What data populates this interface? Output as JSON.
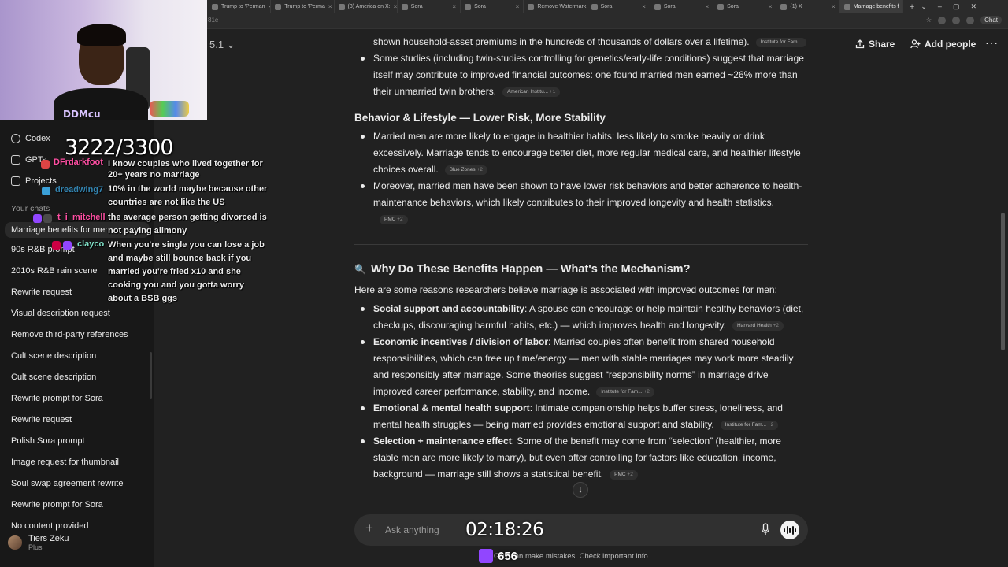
{
  "browser": {
    "tabs": [
      {
        "label": "Trump to 'Perman"
      },
      {
        "label": "Trump to 'Perma"
      },
      {
        "label": "(3) America on X:"
      },
      {
        "label": "Sora"
      },
      {
        "label": "Sora"
      },
      {
        "label": "Remove Watermark"
      },
      {
        "label": "Sora"
      },
      {
        "label": "Sora"
      },
      {
        "label": "Sora"
      },
      {
        "label": "(1) X"
      },
      {
        "label": "Marriage benefits f"
      }
    ],
    "url_fragment": "81e",
    "ext_chat_label": "Chat"
  },
  "sidebar": {
    "items": [
      {
        "label": "Codex"
      },
      {
        "label": "GPTs"
      },
      {
        "label": "Projects"
      }
    ],
    "section_label": "Your chats",
    "chats": [
      {
        "label": "Marriage benefits for men"
      },
      {
        "label": "90s R&B prompt"
      },
      {
        "label": "2010s R&B rain scene"
      },
      {
        "label": "Rewrite request"
      },
      {
        "label": "Visual description request"
      },
      {
        "label": "Remove third-party references"
      },
      {
        "label": "Cult scene description"
      },
      {
        "label": "Cult scene description"
      },
      {
        "label": "Rewrite prompt for Sora"
      },
      {
        "label": "Rewrite request"
      },
      {
        "label": "Polish Sora prompt"
      },
      {
        "label": "Image request for thumbnail"
      },
      {
        "label": "Soul swap agreement rewrite"
      },
      {
        "label": "Rewrite prompt for Sora"
      },
      {
        "label": "No content provided"
      }
    ],
    "user": {
      "name": "Tiers Zeku",
      "plan": "Plus"
    }
  },
  "header": {
    "model_label": "5.1 ⌄",
    "share_label": "Share",
    "add_people_label": "Add people",
    "more_label": "···"
  },
  "content": {
    "frag1_tail": "shown household-asset premiums in the hundreds of thousands of dollars over a lifetime).",
    "frag1_cite": "Institute for Fam...",
    "b1": {
      "text": "Some studies (including twin-studies controlling for genetics/early-life conditions) suggest that marriage itself may contribute to improved financial outcomes: one found married men earned ~26% more than their unmarried twin brothers.",
      "cite": "American Institu...",
      "cite_more": "+1"
    },
    "h_behavior": "Behavior & Lifestyle — Lower Risk, More Stability",
    "b2": {
      "text": "Married men are more likely to engage in healthier habits: less likely to smoke heavily or drink excessively. Marriage tends to encourage better diet, more regular medical care, and healthier lifestyle choices overall.",
      "cite": "Blue Zones",
      "cite_more": "+2"
    },
    "b3": {
      "text": "Moreover, married men have been shown to have lower risk behaviors and better adherence to health-maintenance behaviors, which likely contributes to their improved longevity and health statistics.",
      "cite": "PMC",
      "cite_more": "+2"
    },
    "h_mechanism_icon": "🔍",
    "h_mechanism": "Why Do These Benefits Happen — What's the Mechanism?",
    "intro": "Here are some reasons researchers believe marriage is associated with improved outcomes for men:",
    "m1": {
      "bold": "Social support and accountability",
      "text": ": A spouse can encourage or help maintain healthy behaviors (diet, checkups, discouraging harmful habits, etc.) — which improves health and longevity.",
      "cite": "Harvard Health",
      "cite_more": "+2"
    },
    "m2": {
      "bold": "Economic incentives / division of labor",
      "text": ": Married couples often benefit from shared household responsibilities, which can free up time/energy — men with stable marriages may work more steadily and responsibly after marriage. Some theories suggest “responsibility norms” in marriage drive improved career performance, stability, and income.",
      "cite": "Institute for Fam...",
      "cite_more": "+2"
    },
    "m3": {
      "bold": "Emotional & mental health support",
      "text": ": Intimate companionship helps buffer stress, loneliness, and mental health struggles — being married provides emotional support and stability.",
      "cite": "Institute for Fam...",
      "cite_more": "+2"
    },
    "m4": {
      "bold": "Selection + maintenance effect",
      "text": ": Some of the benefit may come from “selection” (healthier, more stable men are more likely to marry), but even after controlling for factors like education, income, background — marriage still shows a statistical benefit.",
      "cite": "PMC",
      "cite_more": "+2"
    }
  },
  "composer": {
    "placeholder": "Ask anything",
    "disclaimer": "GPT can make mistakes. Check important info."
  },
  "overlay": {
    "counter": "3222/3300",
    "timer": "02:18:26",
    "viewers": "656",
    "webcam_logo": "DDMcu",
    "chat": [
      {
        "user": "DFrdarkfoot",
        "user_color": "#ff4fa3",
        "lines": [
          "I know couples who lived together for",
          "20+ years no marriage"
        ]
      },
      {
        "user": "dreadwing7",
        "user_color": "#3aa0d8",
        "lines": [
          "10% in the world maybe because other",
          "countries are not like the US"
        ]
      },
      {
        "user": "t_i_mitchell",
        "user_color": "#ff4fa3",
        "lines": [
          "the average person getting divorced is",
          "not paying alimony"
        ]
      },
      {
        "user": "clayco",
        "user_color": "#7fe0c7",
        "lines": [
          "When you're single you can lose a job",
          "and maybe still bounce back if you",
          "married you're fried x10 and she",
          "cooking you and you gotta worry",
          "about a BSB ggs"
        ]
      }
    ]
  }
}
